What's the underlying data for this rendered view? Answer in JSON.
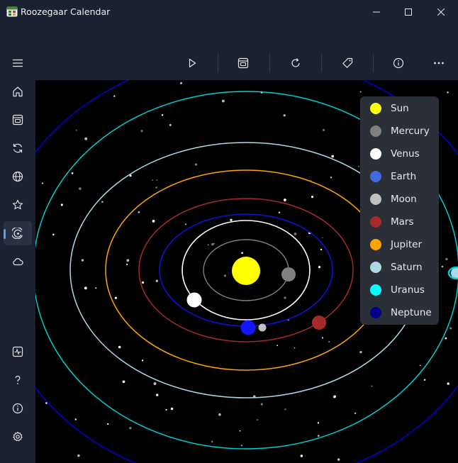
{
  "window": {
    "title": "Roozegaar Calendar"
  },
  "toolbar": {
    "buttons": [
      {
        "name": "play-button",
        "icon": "play-icon"
      },
      {
        "name": "calendar-button",
        "icon": "calendar-icon"
      },
      {
        "name": "refresh-button",
        "icon": "refresh-icon"
      },
      {
        "name": "tag-button",
        "icon": "tag-icon"
      },
      {
        "name": "info-button",
        "icon": "info-icon"
      },
      {
        "name": "more-button",
        "icon": "more-icon"
      }
    ]
  },
  "sidebar": {
    "items": [
      {
        "name": "menu",
        "icon": "hamburger-icon"
      },
      {
        "name": "home",
        "icon": "home-icon"
      },
      {
        "name": "calendar",
        "icon": "calendar-icon"
      },
      {
        "name": "converter",
        "icon": "refresh-icon"
      },
      {
        "name": "world",
        "icon": "globe-icon"
      },
      {
        "name": "favorites",
        "icon": "star-icon"
      },
      {
        "name": "solar-system",
        "icon": "orbit-icon",
        "active": true
      },
      {
        "name": "weather",
        "icon": "cloud-icon"
      },
      {
        "name": "activity",
        "icon": "pulse-icon"
      },
      {
        "name": "help",
        "icon": "question-icon"
      },
      {
        "name": "about",
        "icon": "info-icon"
      },
      {
        "name": "settings",
        "icon": "gear-icon"
      }
    ]
  },
  "legend": {
    "items": [
      {
        "label": "Sun",
        "color": "#ffff00"
      },
      {
        "label": "Mercury",
        "color": "#808080"
      },
      {
        "label": "Venus",
        "color": "#ffffff"
      },
      {
        "label": "Earth",
        "color": "#4169e1"
      },
      {
        "label": "Moon",
        "color": "#c0c0c0"
      },
      {
        "label": "Mars",
        "color": "#a52a2a"
      },
      {
        "label": "Jupiter",
        "color": "#ffa500"
      },
      {
        "label": "Saturn",
        "color": "#add8e6"
      },
      {
        "label": "Uranus",
        "color": "#00ffff"
      },
      {
        "label": "Neptune",
        "color": "#00008b"
      }
    ]
  },
  "colors": {
    "background": "#1b2130",
    "canvas": "#000000",
    "accent": "#5aa0e6",
    "mercury_orbit": "#808080",
    "venus_orbit": "#ffffff",
    "earth_orbit": "#1010d0",
    "mars_orbit": "#a52a2a",
    "jupiter_orbit": "#ffa500",
    "saturn_orbit": "#add8e6",
    "uranus_orbit": "#00ced1",
    "neptune_orbit": "#0000cd"
  }
}
